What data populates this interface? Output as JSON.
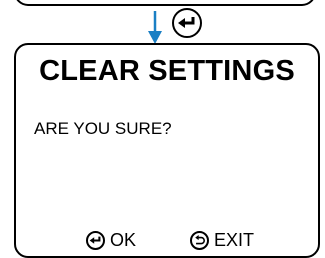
{
  "flow": {
    "arrow_color": "#1a7fc4",
    "key_icon": "enter-icon"
  },
  "screen": {
    "title": "CLEAR SETTINGS",
    "message": "ARE YOU SURE?",
    "soft_keys": {
      "ok": {
        "icon": "enter-icon",
        "label": "OK"
      },
      "exit": {
        "icon": "back-icon",
        "label": "EXIT"
      }
    }
  }
}
